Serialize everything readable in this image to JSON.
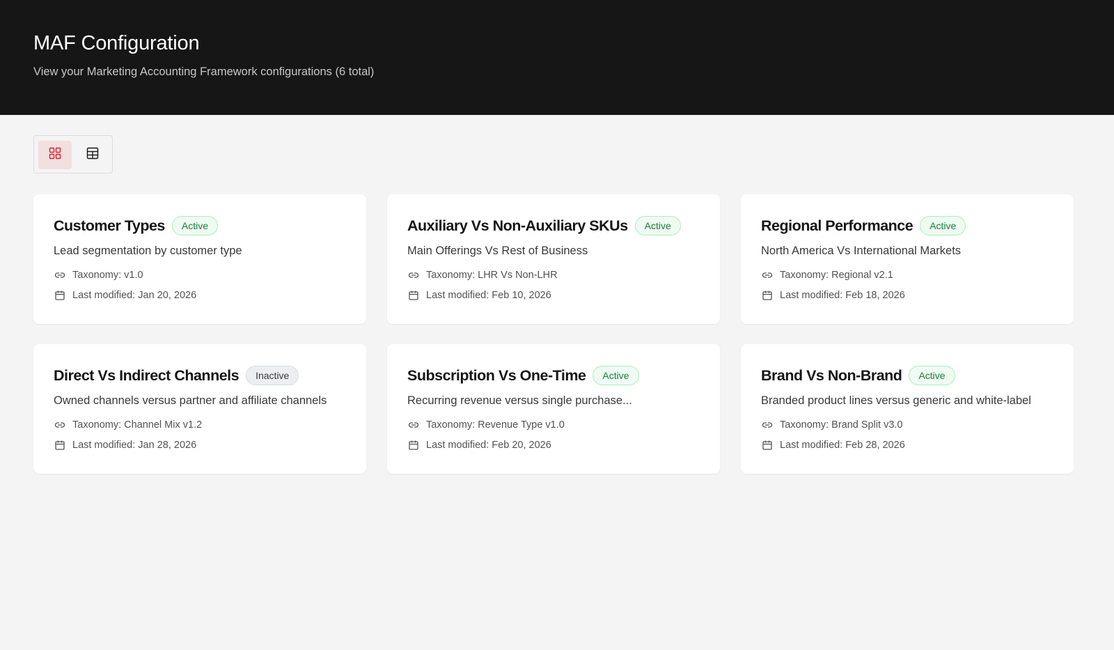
{
  "header": {
    "title": "MAF Configuration",
    "subtitle": "View your Marketing Accounting Framework configurations (6 total)"
  },
  "view_toggle": {
    "selected": "grid",
    "options": [
      "grid-view-icon",
      "table-view-icon"
    ],
    "accent": "#da1e28"
  },
  "cards": [
    {
      "title": "Customer Types",
      "status": "Active",
      "description": "Lead segmentation by customer type",
      "taxonomy": "Taxonomy: v1.0",
      "modified": "Last modified: Jan 20, 2026"
    },
    {
      "title": "Auxiliary Vs Non-Auxiliary SKUs",
      "status": "Active",
      "description": "Main Offerings Vs Rest of Business",
      "taxonomy": "Taxonomy: LHR Vs Non-LHR",
      "modified": "Last modified: Feb 10, 2026"
    },
    {
      "title": "Regional Performance",
      "status": "Active",
      "description": "North America Vs International Markets",
      "taxonomy": "Taxonomy: Regional v2.1",
      "modified": "Last modified: Feb 18, 2026"
    },
    {
      "title": "Direct Vs Indirect Channels",
      "status": "Inactive",
      "description": "Owned channels versus partner and affiliate channels",
      "taxonomy": "Taxonomy: Channel Mix v1.2",
      "modified": "Last modified: Jan 28, 2026"
    },
    {
      "title": "Subscription Vs One-Time",
      "status": "Active",
      "description": "Recurring revenue versus single purchase...",
      "taxonomy": "Taxonomy: Revenue Type v1.0",
      "modified": "Last modified: Feb 20, 2026"
    },
    {
      "title": "Brand Vs Non-Brand",
      "status": "Active",
      "description": "Branded product lines versus generic and white-label",
      "taxonomy": "Taxonomy: Brand Split v3.0",
      "modified": "Last modified: Feb 28, 2026"
    }
  ],
  "colors": {
    "header_bg": "#161616",
    "page_bg": "#f4f4f4",
    "active_text": "#198038",
    "active_bg": "#effaf3",
    "inactive_bg": "#eceef1"
  }
}
